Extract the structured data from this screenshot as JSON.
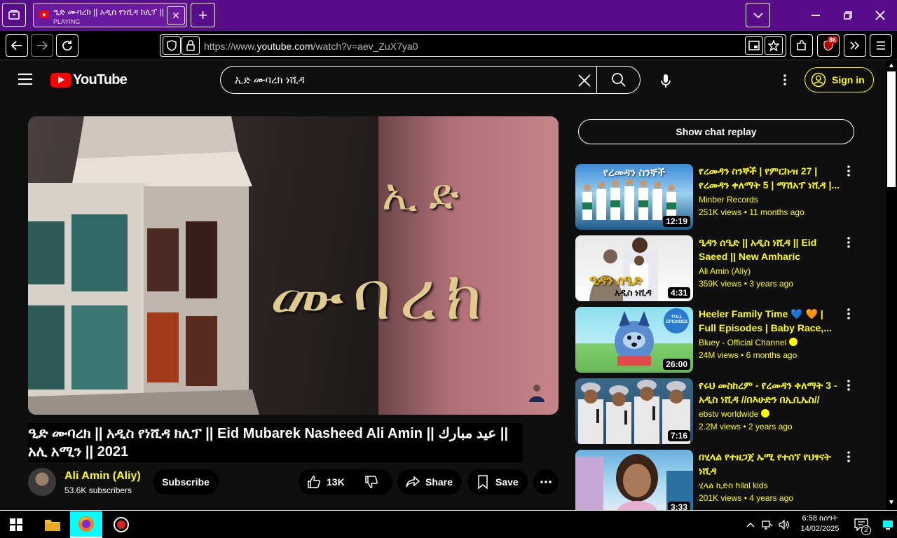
{
  "browser": {
    "tab": {
      "title": "ዒድ ሙባረክ || አዲስ የነሺዳ ክሊፕ || Eid Mubarek Nasheed Ali Amin",
      "status": "PLAYING"
    },
    "url_prefix": "https://www.",
    "url_domain": "youtube.com",
    "url_path": "/watch?v=aev_ZuX7ya0",
    "extension_badge": "86"
  },
  "youtube": {
    "logo_text": "YouTube",
    "search_query": "ኢድ ሙባረክ ነሺዳ",
    "sign_in": "Sign in",
    "player_overlay": {
      "line1": "ኢድ",
      "line2": "ሙባረክ"
    },
    "video": {
      "title": "ዒድ ሙባረክ || አዲስ የነሺዳ ክሊፕ || Eid Mubarek Nasheed Ali Amin || عيد مبارك || አሊ አሚን || 2021",
      "channel": "Ali Amin (Aliy)",
      "subscribers": "53.6K subscribers",
      "subscribe": "Subscribe",
      "likes": "13K",
      "share": "Share",
      "save": "Save"
    },
    "show_chat_replay": "Show chat replay",
    "recommendations": [
      {
        "title": "የረመዳን ስንኞች | የምርኩዝ 27 | የረመዳን ቀለማት 5 | ማሽአፕ ነሺዳ |...",
        "channel": "Minber Records",
        "views": "251K views",
        "age": "11 months ago",
        "duration": "12:19",
        "verified": false
      },
      {
        "title": "ዒዳን ሰዒድ || አዲስ ነሺዳ || Eid Saeed || New Amharic Nashee...",
        "channel": "Ali Amin (Aliy)",
        "views": "359K views",
        "age": "3 years ago",
        "duration": "4:31",
        "verified": false
      },
      {
        "title": "Heeler Family Time 💙 🧡 | Full Episodes | Baby Race,...",
        "channel": "Bluey - Official Channel",
        "views": "24M views",
        "age": "6 months ago",
        "duration": "26:00",
        "verified": true
      },
      {
        "title": "የሩህ መስከረም - የረመዳን ቀለማት 3 - አዲስ ነሺዳ //በእሁድን በኢቢኤስ//",
        "channel": "ebstv worldwide",
        "views": "2.2M views",
        "age": "2 years ago",
        "duration": "7:16",
        "verified": true
      },
      {
        "title": "በሂላል የተዘጋጀ ኡሚ የተሰኘ የህፃናት ነሺዳ",
        "channel": "ሂላል ኪድስ hilal kids",
        "views": "201K views",
        "age": "4 years ago",
        "duration": "3:33",
        "verified": false
      }
    ],
    "thumb_text": {
      "t1": "የረመዳን ስንኞች",
      "t2": "ዒዳን ሰዒድ",
      "t2b": "አዲስ ነሺዳ",
      "t3": "FULL EPISODES"
    }
  },
  "taskbar": {
    "time": "6:58 ከሰዓት",
    "date": "14/02/2025",
    "notifications": "2"
  }
}
